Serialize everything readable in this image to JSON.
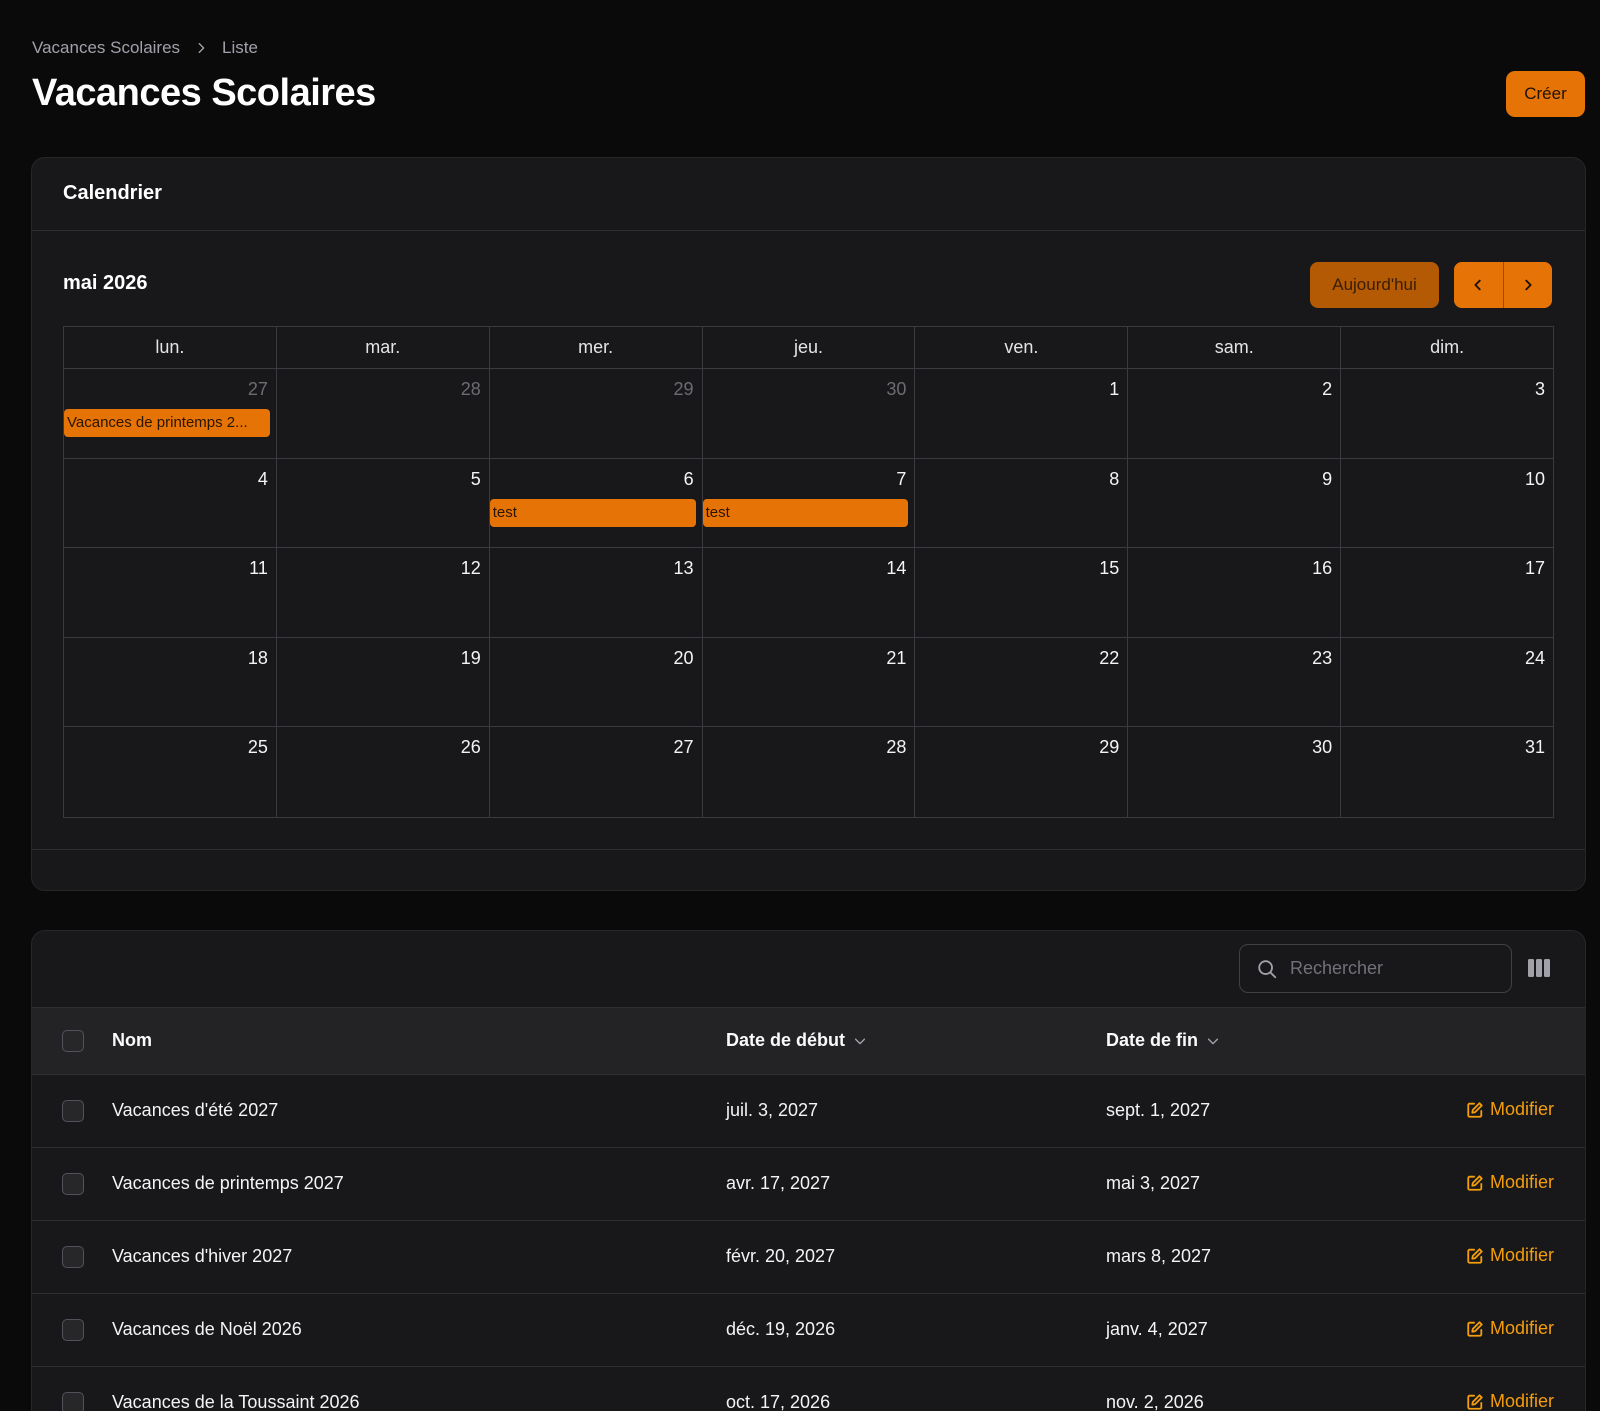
{
  "breadcrumb": {
    "parent": "Vacances Scolaires",
    "current": "Liste"
  },
  "page": {
    "title": "Vacances Scolaires",
    "create_label": "Créer"
  },
  "calendar": {
    "card_title": "Calendrier",
    "month_label": "mai 2026",
    "today_label": "Aujourd'hui",
    "weekdays": [
      "lun.",
      "mar.",
      "mer.",
      "jeu.",
      "ven.",
      "sam.",
      "dim."
    ],
    "weeks": [
      [
        {
          "day": "27",
          "other": true,
          "event": "Vacances de printemps 2..."
        },
        {
          "day": "28",
          "other": true
        },
        {
          "day": "29",
          "other": true
        },
        {
          "day": "30",
          "other": true
        },
        {
          "day": "1"
        },
        {
          "day": "2"
        },
        {
          "day": "3"
        }
      ],
      [
        {
          "day": "4"
        },
        {
          "day": "5"
        },
        {
          "day": "6",
          "event": "test"
        },
        {
          "day": "7",
          "event": "test"
        },
        {
          "day": "8"
        },
        {
          "day": "9"
        },
        {
          "day": "10"
        }
      ],
      [
        {
          "day": "11"
        },
        {
          "day": "12"
        },
        {
          "day": "13"
        },
        {
          "day": "14"
        },
        {
          "day": "15"
        },
        {
          "day": "16"
        },
        {
          "day": "17"
        }
      ],
      [
        {
          "day": "18"
        },
        {
          "day": "19"
        },
        {
          "day": "20"
        },
        {
          "day": "21"
        },
        {
          "day": "22"
        },
        {
          "day": "23"
        },
        {
          "day": "24"
        }
      ],
      [
        {
          "day": "25"
        },
        {
          "day": "26"
        },
        {
          "day": "27"
        },
        {
          "day": "28"
        },
        {
          "day": "29"
        },
        {
          "day": "30"
        },
        {
          "day": "31"
        }
      ]
    ]
  },
  "table": {
    "search_placeholder": "Rechercher",
    "columns": {
      "name": "Nom",
      "start": "Date de début",
      "end": "Date de fin"
    },
    "edit_label": "Modifier",
    "rows": [
      {
        "name": "Vacances d'été 2027",
        "start": "juil. 3, 2027",
        "end": "sept. 1, 2027"
      },
      {
        "name": "Vacances de printemps 2027",
        "start": "avr. 17, 2027",
        "end": "mai 3, 2027"
      },
      {
        "name": "Vacances d'hiver 2027",
        "start": "févr. 20, 2027",
        "end": "mars 8, 2027"
      },
      {
        "name": "Vacances de Noël 2026",
        "start": "déc. 19, 2026",
        "end": "janv. 4, 2027"
      },
      {
        "name": "Vacances de la Toussaint 2026",
        "start": "oct. 17, 2026",
        "end": "nov. 2, 2026"
      }
    ]
  },
  "colors": {
    "accent": "#e67306",
    "link": "#f59e0b",
    "background": "#0a0a0b",
    "card": "#18181b"
  }
}
